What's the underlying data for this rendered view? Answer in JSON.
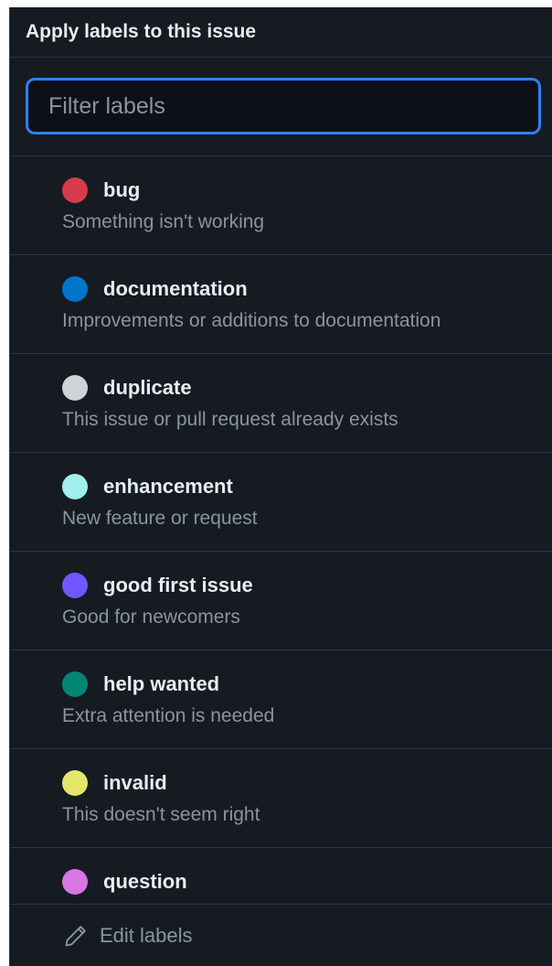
{
  "header": {
    "title": "Apply labels to this issue"
  },
  "filter": {
    "placeholder": "Filter labels",
    "value": ""
  },
  "labels": [
    {
      "name": "bug",
      "description": "Something isn't working",
      "color": "#d73a4a"
    },
    {
      "name": "documentation",
      "description": "Improvements or additions to documentation",
      "color": "#0075ca"
    },
    {
      "name": "duplicate",
      "description": "This issue or pull request already exists",
      "color": "#cfd3d7"
    },
    {
      "name": "enhancement",
      "description": "New feature or request",
      "color": "#a2eeef"
    },
    {
      "name": "good first issue",
      "description": "Good for newcomers",
      "color": "#7057ff"
    },
    {
      "name": "help wanted",
      "description": "Extra attention is needed",
      "color": "#008672"
    },
    {
      "name": "invalid",
      "description": "This doesn't seem right",
      "color": "#e4e669"
    },
    {
      "name": "question",
      "description": "",
      "color": "#d876e3"
    }
  ],
  "footer": {
    "edit_label": "Edit labels",
    "icon": "pencil-icon"
  },
  "theme": {
    "accent": "#2f81f7",
    "background": "#161b22"
  }
}
